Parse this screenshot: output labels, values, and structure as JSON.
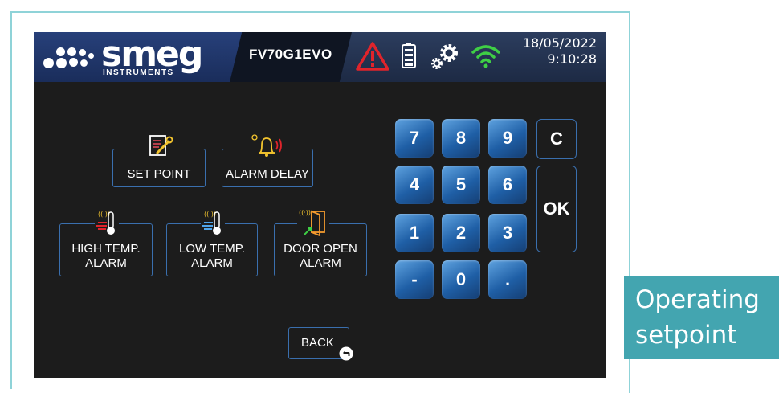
{
  "header": {
    "logo": {
      "brand": "smeg",
      "sub": "INSTRUMENTS"
    },
    "model": "FV70G1EVO",
    "date": "18/05/2022",
    "time": "9:10:28",
    "icons": [
      "alarm-warning-icon",
      "battery-icon",
      "settings-gears-icon",
      "wifi-icon"
    ],
    "colors": {
      "warning": "#e0242b",
      "wifi": "#3fcf45"
    }
  },
  "menu": {
    "set_point": "SET POINT",
    "alarm_delay": "ALARM DELAY",
    "high_temp_l1": "HIGH TEMP.",
    "high_temp_l2": "ALARM",
    "low_temp_l1": "LOW TEMP.",
    "low_temp_l2": "ALARM",
    "door_l1": "DOOR OPEN",
    "door_l2": "ALARM"
  },
  "keypad": {
    "k7": "7",
    "k8": "8",
    "k9": "9",
    "clear": "C",
    "k4": "4",
    "k5": "5",
    "k6": "6",
    "ok": "OK",
    "k1": "1",
    "k2": "2",
    "k3": "3",
    "minus": "-",
    "k0": "0",
    "dot": "."
  },
  "back_label": "BACK",
  "tooltip": {
    "line1": "Operating",
    "line2": "setpoint"
  }
}
